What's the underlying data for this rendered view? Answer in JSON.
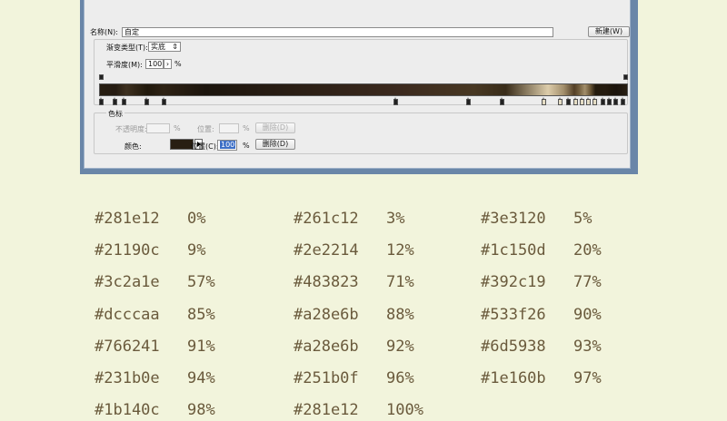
{
  "dialog": {
    "name_label": "名称(N):",
    "name_value": "自定",
    "new_button": "新建(W)",
    "gradient_type_label": "渐变类型(T):",
    "gradient_type_value": "实底",
    "smoothness_label": "平滑度(M):",
    "smoothness_value": "100",
    "smoothness_unit": "%",
    "stops_group_label": "色标",
    "opacity_label": "不透明度:",
    "opacity_unit": "%",
    "opacity_location_label": "位置:",
    "opacity_location_unit": "%",
    "opacity_delete_button": "删除(D)",
    "color_label": "颜色:",
    "color_value": "#281e12",
    "location_label": "位置(C):",
    "location_value": "100",
    "location_unit": "%",
    "delete_button": "删除(D)"
  },
  "stops": [
    {
      "color": "#281e12",
      "percent": "0%"
    },
    {
      "color": "#261c12",
      "percent": "3%"
    },
    {
      "color": "#3e3120",
      "percent": "5%"
    },
    {
      "color": "#21190c",
      "percent": "9%"
    },
    {
      "color": "#2e2214",
      "percent": "12%"
    },
    {
      "color": "#1c150d",
      "percent": "20%"
    },
    {
      "color": "#3c2a1e",
      "percent": "57%"
    },
    {
      "color": "#483823",
      "percent": "71%"
    },
    {
      "color": "#392c19",
      "percent": "77%"
    },
    {
      "color": "#dcccaa",
      "percent": "85%"
    },
    {
      "color": "#a28e6b",
      "percent": "88%"
    },
    {
      "color": "#533f26",
      "percent": "90%"
    },
    {
      "color": "#766241",
      "percent": "91%"
    },
    {
      "color": "#a28e6b",
      "percent": "92%"
    },
    {
      "color": "#6d5938",
      "percent": "93%"
    },
    {
      "color": "#231b0e",
      "percent": "94%"
    },
    {
      "color": "#251b0f",
      "percent": "96%"
    },
    {
      "color": "#1e160b",
      "percent": "97%"
    },
    {
      "color": "#1b140c",
      "percent": "98%"
    },
    {
      "color": "#281e12",
      "percent": "100%"
    }
  ]
}
